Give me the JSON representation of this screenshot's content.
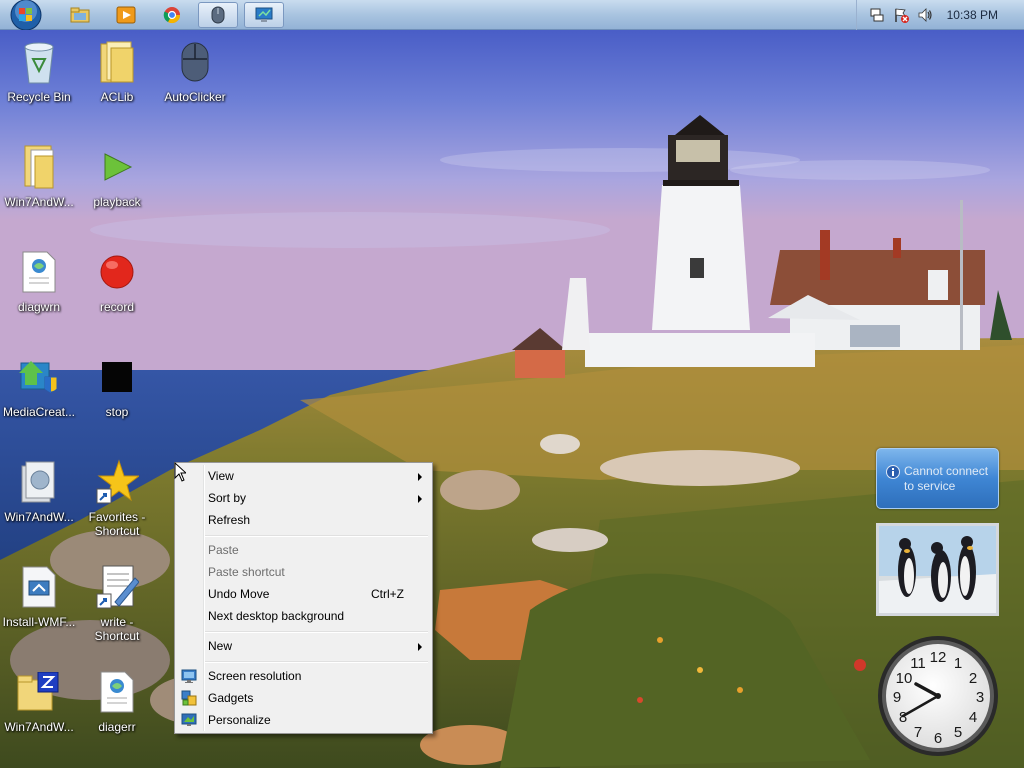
{
  "taskbar": {
    "clock": "10:38 PM"
  },
  "desktop_icons": [
    {
      "label": "Recycle Bin"
    },
    {
      "label": "ACLib"
    },
    {
      "label": "AutoClicker"
    },
    {
      "label": "Win7AndW..."
    },
    {
      "label": "playback"
    },
    {
      "label": "diagwrn"
    },
    {
      "label": "record"
    },
    {
      "label": "MediaCreat..."
    },
    {
      "label": "stop"
    },
    {
      "label": "Win7AndW..."
    },
    {
      "label": "Favorites -\nShortcut"
    },
    {
      "label": "Install-WMF..."
    },
    {
      "label": "write -\nShortcut"
    },
    {
      "label": "Win7AndW..."
    },
    {
      "label": "diagerr"
    }
  ],
  "context_menu": {
    "view": "View",
    "sort_by": "Sort by",
    "refresh": "Refresh",
    "paste": "Paste",
    "paste_shortcut": "Paste shortcut",
    "undo_move": "Undo Move",
    "undo_shortcut": "Ctrl+Z",
    "next_background": "Next desktop background",
    "new": "New",
    "screen_resolution": "Screen resolution",
    "gadgets": "Gadgets",
    "personalize": "Personalize"
  },
  "gadgets": {
    "news_message": "Cannot connect to service"
  }
}
